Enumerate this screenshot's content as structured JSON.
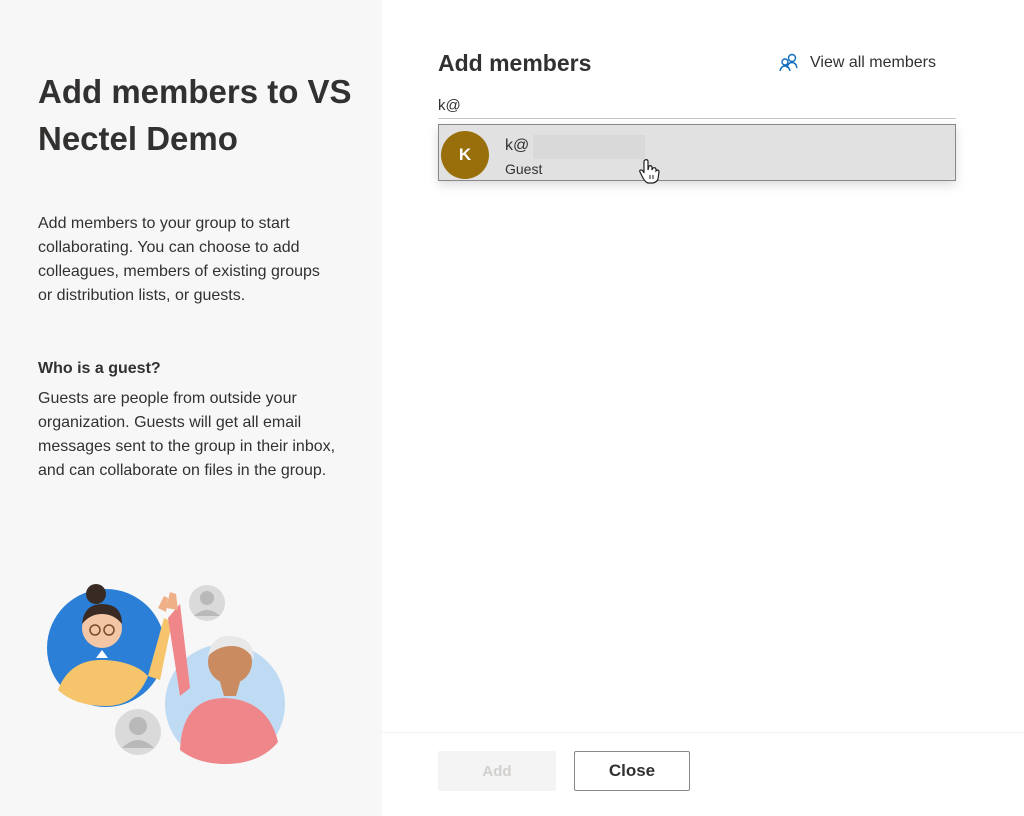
{
  "left": {
    "title": "Add members to VS Nectel Demo",
    "description": "Add members to your group to start collaborating. You can choose to add colleagues, members of existing groups or distribution lists, or guests.",
    "guest_heading": "Who is a guest?",
    "guest_description": "Guests are people from outside your organization. Guests will get all email messages sent to the group in their inbox, and can collaborate on files in the group.",
    "illustration_icon": "people-high-five-illustration"
  },
  "main": {
    "title": "Add members",
    "view_all_label": "View all members",
    "view_all_icon": "people-icon",
    "search_value": "k@",
    "suggestion": {
      "initial": "K",
      "name": "k@",
      "type": "Guest",
      "avatar_color": "#986f0b"
    }
  },
  "footer": {
    "add_label": "Add",
    "close_label": "Close"
  },
  "colors": {
    "accent_avatar": "#986f0b",
    "left_background": "#f7f7f8",
    "text": "#323130"
  }
}
